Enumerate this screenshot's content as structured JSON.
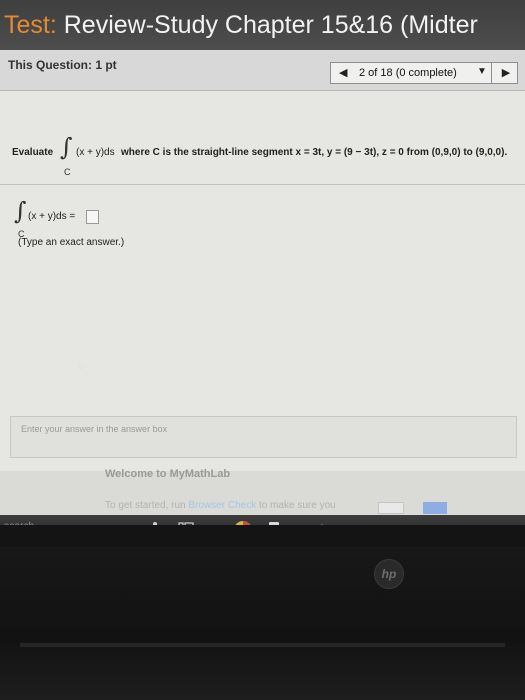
{
  "window": {
    "title_prefix": "Test:",
    "title": " Review-Study Chapter 15&16 (Midter"
  },
  "question_bar": {
    "points": "This Question: 1 pt",
    "prev_icon": "◀",
    "counter": "2 of 18 (0 complete)",
    "dropdown_icon": "▼",
    "next_icon": "▶"
  },
  "question": {
    "evaluate": "Evaluate",
    "integral_symbol": "∫",
    "sub": "C",
    "integrand": "(x + y)ds",
    "text": "where C is the straight-line segment x = 3t, y = (9 − 3t), z = 0 from (0,9,0) to (9,0,0)."
  },
  "answer": {
    "integral_symbol": "∫",
    "sub": "C",
    "lhs": "(x + y)ds =",
    "hint": "(Type an exact answer.)"
  },
  "status": {
    "prompt": "Enter your answer in the answer box"
  },
  "banner": {
    "title": "Welcome to MyMathLab",
    "line_start": "To get started, run ",
    "link": "Browser Check",
    "line_end": " to make sure you",
    "close_icon": "×"
  },
  "taskbar": {
    "search": "search"
  },
  "device": {
    "logo": "hp"
  },
  "colors": {
    "title_bg": "#464646",
    "accent_orange": "#e58a33",
    "taskbar_bg": "#2e2e2e"
  }
}
